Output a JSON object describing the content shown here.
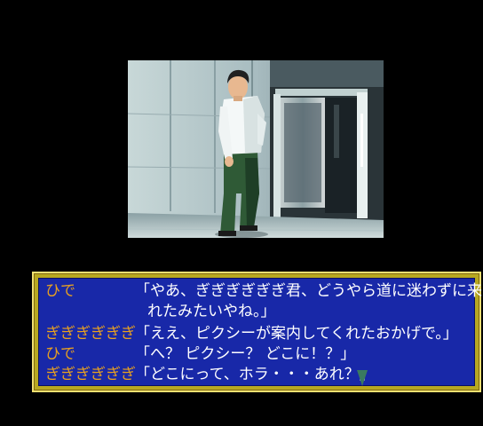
{
  "scene": {
    "description_icon": "photo-scene-icon"
  },
  "dialog": {
    "lines": [
      {
        "speaker": "ひで",
        "text": "「やあ、ぎぎぎぎぎぎ君、どうやら道に迷わずに来"
      },
      {
        "speaker": "",
        "text": "れたみたいやね。」"
      },
      {
        "speaker": "ぎぎぎぎぎぎ",
        "text": "「ええ、ピクシーが案内してくれたおかげで。」"
      },
      {
        "speaker": "ひで",
        "text": "「へ？ ピクシー？ どこに！？」"
      },
      {
        "speaker": "ぎぎぎぎぎぎ",
        "text": "「どこにって、ホラ・・・あれ？」"
      }
    ],
    "advance_icon": "triangle-down-icon"
  },
  "colors": {
    "background": "#000000",
    "dialog_fill": "#1828a8",
    "dialog_border": "#b8a820",
    "speaker_text": "#e8a020",
    "speech_text": "#ffffff",
    "cursor": "#3a7a60"
  }
}
